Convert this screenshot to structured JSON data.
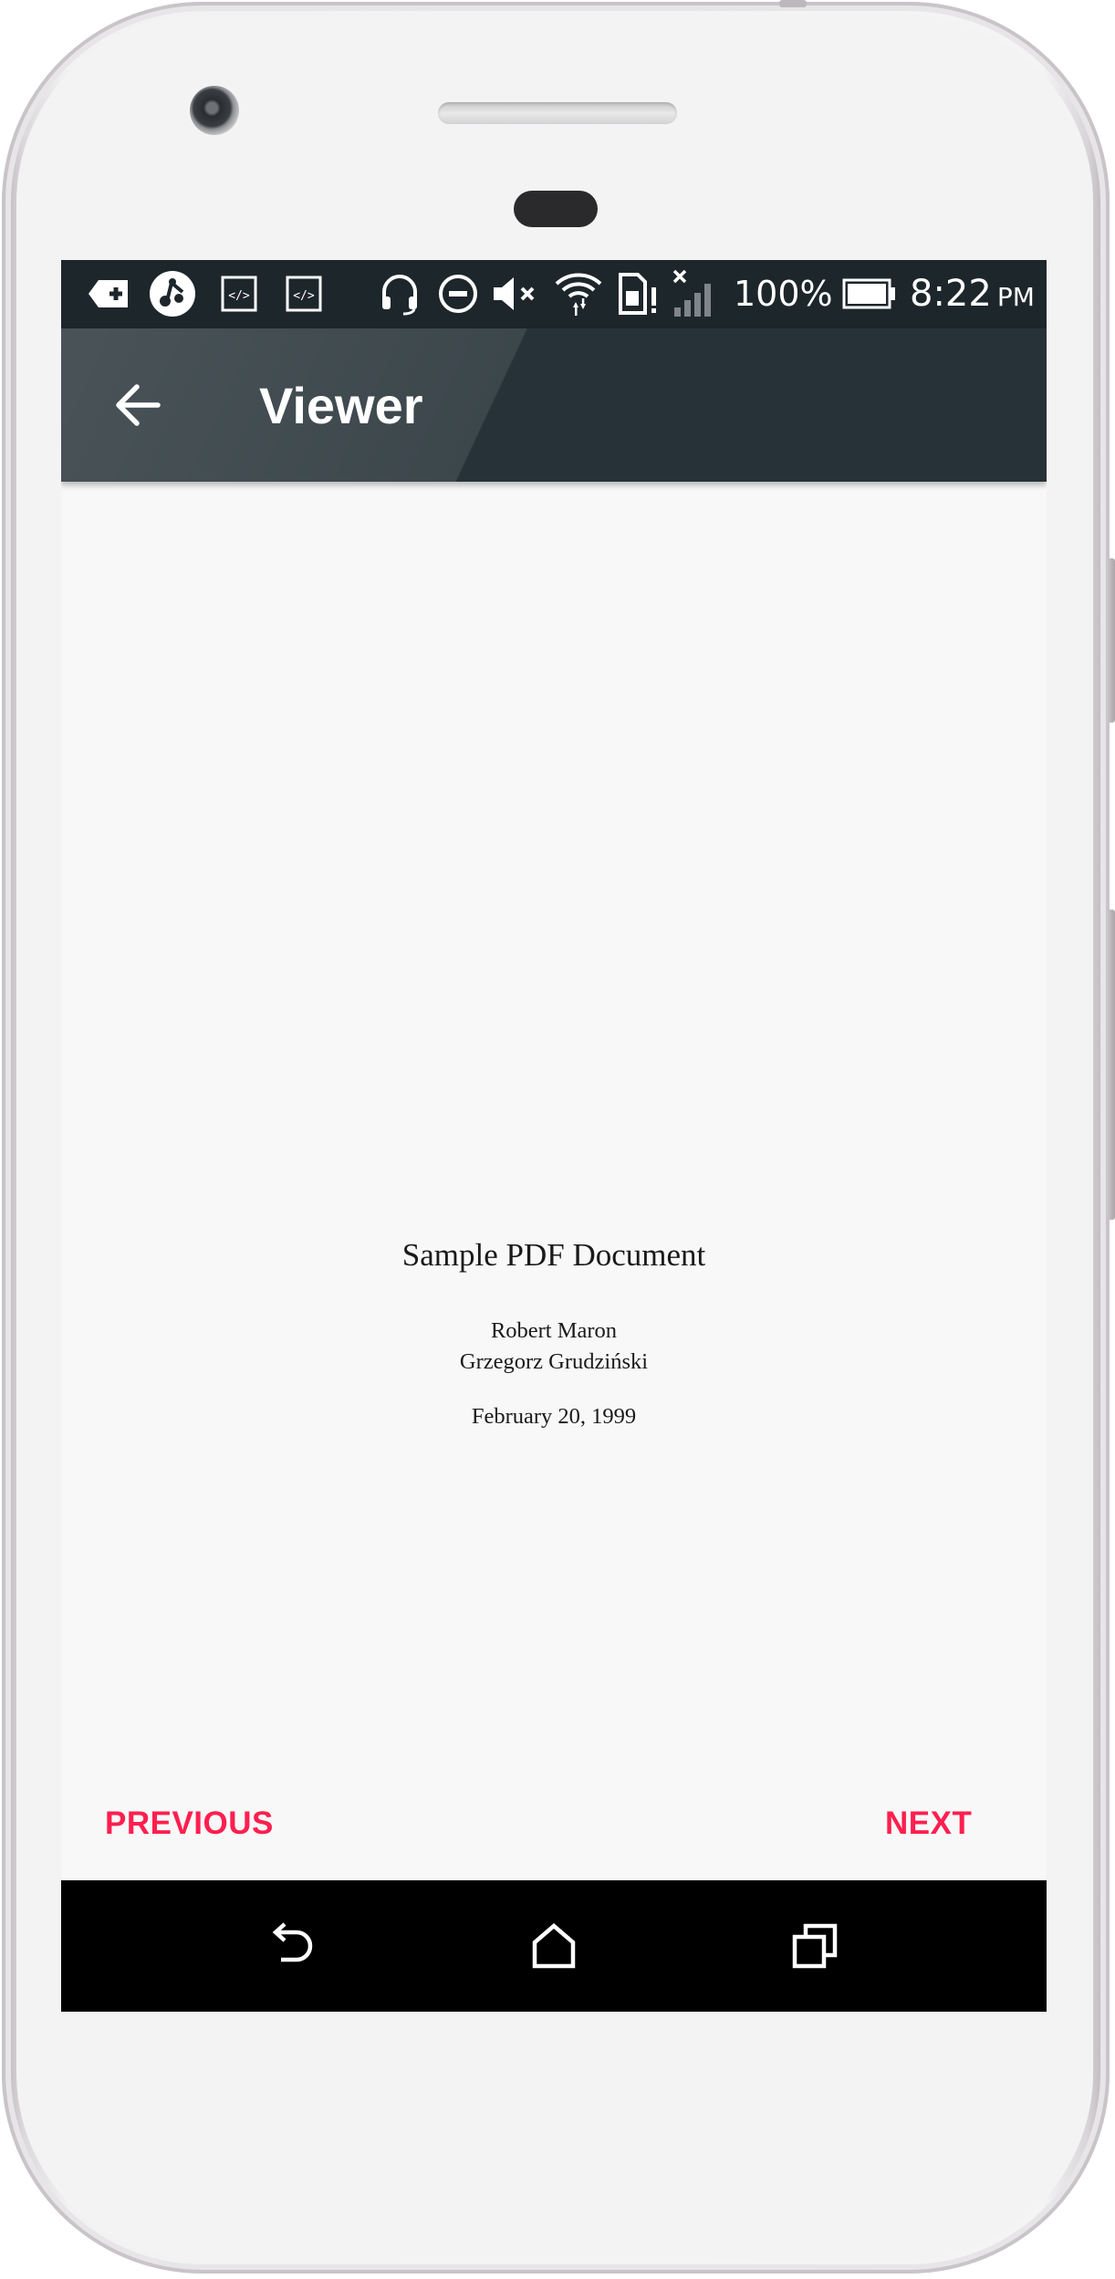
{
  "status_bar": {
    "icons": [
      "add-notification-icon",
      "music-app-icon",
      "code-window-icon",
      "code-window-icon",
      "headset-icon",
      "do-not-disturb-icon",
      "volume-muted-icon",
      "wifi-icon",
      "sim-alert-icon",
      "signal-no-service-icon",
      "battery-icon"
    ],
    "battery_percent": "100%",
    "time": "8:22",
    "time_suffix": "PM"
  },
  "app_bar": {
    "title": "Viewer",
    "back_icon": "back-arrow-icon"
  },
  "document": {
    "title": "Sample PDF Document",
    "authors": [
      "Robert Maron",
      "Grzegorz Grudziński"
    ],
    "date": "February 20, 1999"
  },
  "pager": {
    "previous_label": "PREVIOUS",
    "next_label": "NEXT"
  },
  "nav_bar": {
    "icons": [
      "back-icon",
      "home-icon",
      "recents-icon"
    ]
  },
  "colors": {
    "status_bar": "#1d262b",
    "app_bar": "#263238",
    "accent": "#ff1f4f",
    "page_background": "#f8f8f8",
    "nav_bar": "#000000"
  }
}
